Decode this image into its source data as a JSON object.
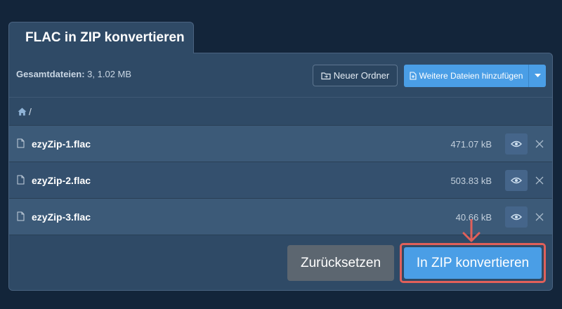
{
  "tab": {
    "title": "FLAC in ZIP konvertieren"
  },
  "header": {
    "total_label": "Gesamtdateien:",
    "total_value": "3, 1.02 MB",
    "new_folder_label": "Neuer Ordner",
    "add_files_label": "Weitere Dateien hinzufügen"
  },
  "breadcrumb": {
    "path": "/"
  },
  "files": [
    {
      "name": "ezyZip-1.flac",
      "size": "471.07 kB"
    },
    {
      "name": "ezyZip-2.flac",
      "size": "503.83 kB"
    },
    {
      "name": "ezyZip-3.flac",
      "size": "40.66 kB"
    }
  ],
  "footer": {
    "reset_label": "Zurücksetzen",
    "convert_label": "In ZIP konvertieren"
  },
  "colors": {
    "background": "#13253a",
    "panel": "#2f4a66",
    "accent": "#4a9ee6",
    "highlight": "#e0605a",
    "reset": "#5c6670"
  },
  "icons": {
    "home": "home-icon",
    "folder": "folder-sync-icon",
    "add_file": "file-add-icon",
    "file": "file-icon",
    "eye": "eye-icon",
    "close": "close-icon",
    "arrow": "arrow-down-icon"
  }
}
